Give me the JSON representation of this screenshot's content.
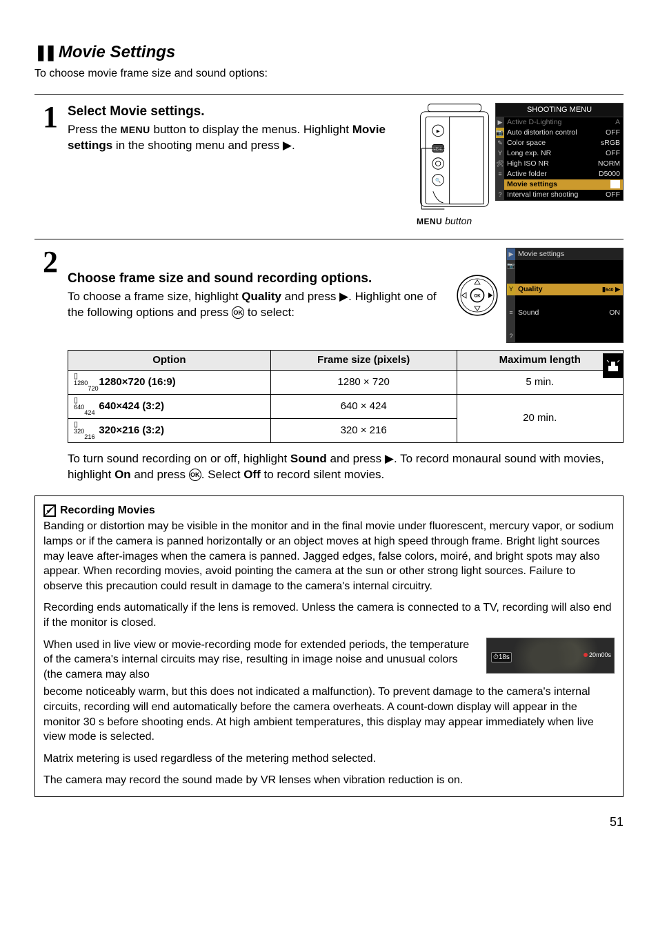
{
  "section": {
    "pause_marks": "❚❚",
    "title": "Movie Settings",
    "intro": "To choose movie frame size and sound options:"
  },
  "step1": {
    "num": "1",
    "title_prefix": "Select ",
    "title_bold": "Movie settings",
    "title_suffix": ".",
    "body_a": "Press the ",
    "menu_word": "MENU",
    "body_b": " button to display the menus. Highlight ",
    "highlight": "Movie settings",
    "body_c": " in the shooting menu and press ",
    "tri": "▶",
    "body_d": ".",
    "caption_label": "MENU",
    "caption_italic": " button"
  },
  "shooting_menu": {
    "title": "SHOOTING MENU",
    "rows": [
      {
        "label": "Active D-Lighting",
        "val": "A",
        "dim": true
      },
      {
        "label": "Auto distortion control",
        "val": "OFF"
      },
      {
        "label": "Color space",
        "val": "sRGB"
      },
      {
        "label": "Long exp. NR",
        "val": "OFF"
      },
      {
        "label": "High ISO NR",
        "val": "NORM"
      },
      {
        "label": "Active folder",
        "val": "D5000"
      },
      {
        "label": "Movie settings",
        "val": "",
        "sel": true
      },
      {
        "label": "Interval timer shooting",
        "val": "OFF"
      }
    ]
  },
  "step2": {
    "num": "2",
    "title": "Choose frame size and sound recording options.",
    "body_a": "To choose a frame size, highlight ",
    "quality": "Quality",
    "body_b": " and press ",
    "tri": "▶",
    "body_c": ". Highlight one of the following options and press ",
    "ok": "OK",
    "body_d": " to select:"
  },
  "movie_settings_panel": {
    "title": "Movie settings",
    "row_quality": "Quality",
    "row_quality_val": "▶",
    "row_sound": "Sound",
    "row_sound_val": "ON"
  },
  "quality_table": {
    "headers": [
      "Option",
      "Frame size (pixels)",
      "Maximum length"
    ],
    "rows": [
      {
        "icon": "1280 720",
        "opt": "1280×720 (16:9)",
        "size": "1280 × 720",
        "len": "5 min."
      },
      {
        "icon": "640 424",
        "opt": "640×424 (3:2)",
        "size": "640 × 424",
        "len": "20 min."
      },
      {
        "icon": "320 216",
        "opt": "320×216 (3:2)",
        "size": "320 × 216",
        "len": ""
      }
    ]
  },
  "sound_para": {
    "a": "To turn sound recording on or off, highlight ",
    "sound": "Sound",
    "b": " and press ",
    "tri": "▶",
    "c": ". To record monaural sound with movies, highlight ",
    "on": "On",
    "d": " and press ",
    "ok": "OK",
    "e": ". Select ",
    "off": "Off",
    "f": " to record silent movies."
  },
  "notes": {
    "title": "Recording Movies",
    "p1": "Banding or distortion may be visible in the monitor and in the final movie under fluorescent, mercury vapor, or sodium lamps or if the camera is panned horizontally or an object moves at high speed through frame.  Bright light sources may leave after-images when the camera is panned.  Jagged edges, false colors, moiré, and bright spots may also appear.  When recording movies, avoid pointing the camera at the sun or other strong light sources.  Failure to observe this precaution could result in damage to the camera's internal circuitry.",
    "p2": "Recording ends automatically if the lens is removed. Unless the camera is connected to a TV, recording will also end if the monitor is closed.",
    "p3a": "When used in live view or movie-recording mode for extended periods, the temperature of the camera's internal circuits may rise, resulting in image noise and unusual colors (the camera may also",
    "p3b": "become noticeably warm, but this does not indicated a malfunction).  To prevent damage to the camera's internal circuits, recording will end automatically before the camera overheats.  A count-down display will appear in the monitor 30 s before shooting ends.  At high ambient temperatures, this display may appear immediately when live view mode is selected.",
    "p4": "Matrix metering is used regardless of the metering method selected.",
    "p5": "The camera may record the sound made by VR lenses when vibration reduction is on.",
    "badge": "18s",
    "rec": "20m00s"
  },
  "page_num": "51",
  "side_tab": "✶"
}
